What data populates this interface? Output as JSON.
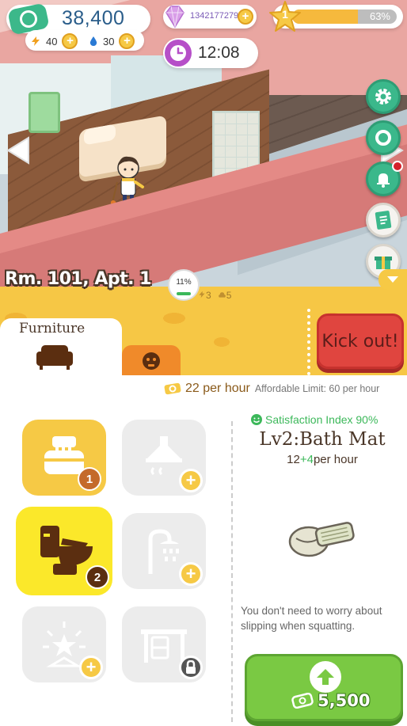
{
  "hud": {
    "money": "38,400",
    "energy": "40",
    "water": "30",
    "gems": "1342177279",
    "time": "12:08",
    "level": "1",
    "level_progress_pct": "63%",
    "level_progress": 0.63
  },
  "room": {
    "name": "Rm. 101, Apt. 1",
    "occupancy": "11%",
    "stat_a": "3",
    "stat_b": "5"
  },
  "buttons": {
    "kick_out": "Kick out!"
  },
  "tabs": {
    "furniture": "Furniture"
  },
  "income": {
    "amount": "22 per hour",
    "limit": "Affordable Limit: 60 per hour"
  },
  "slots": [
    {
      "icon": "bed-icon",
      "badge": "1",
      "state": "owned"
    },
    {
      "icon": "range-hood-icon",
      "badge": "+",
      "state": "empty"
    },
    {
      "icon": "toilet-icon",
      "badge": "2",
      "state": "selected"
    },
    {
      "icon": "shower-icon",
      "badge": "+",
      "state": "empty"
    },
    {
      "icon": "light-icon",
      "badge": "+",
      "state": "empty"
    },
    {
      "icon": "desk-icon",
      "badge": "lock",
      "state": "locked"
    }
  ],
  "detail": {
    "satisfaction": "Satisfaction Index 90%",
    "title": "Lv2:Bath Mat",
    "rate_base": "12",
    "rate_bonus": "+4",
    "rate_unit": "per hour",
    "description": "You don't need to worry about slipping when squatting.",
    "upgrade_price": "5,500"
  },
  "colors": {
    "accent_yellow": "#f6c745",
    "money_green": "#3cb88a",
    "kick_red": "#e0453f",
    "upgrade_green": "#7ac943"
  }
}
